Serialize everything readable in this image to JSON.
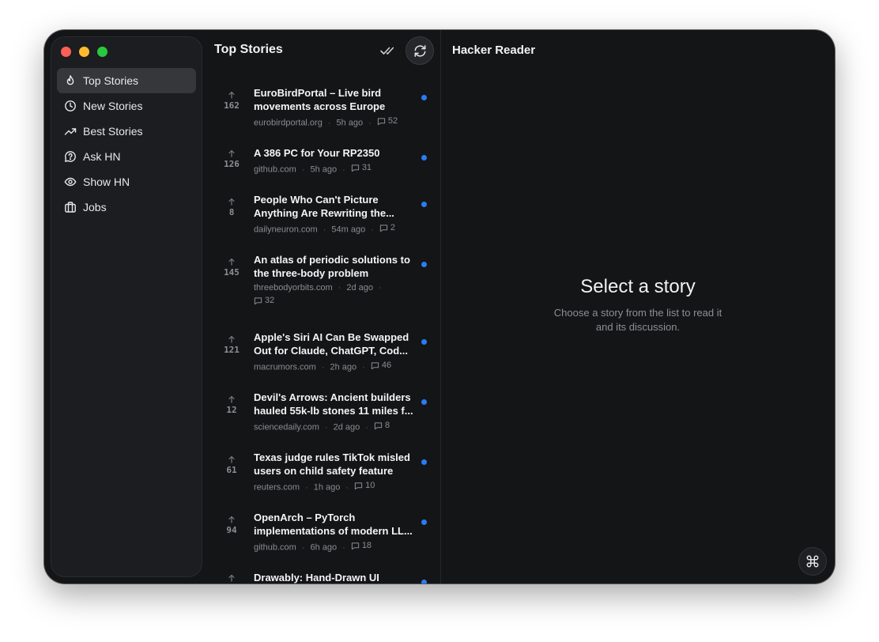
{
  "colors": {
    "accent": "#2a7cf6",
    "close": "#fe5f57",
    "minimize": "#febc2e",
    "zoom": "#28c840"
  },
  "sidebar": {
    "items": [
      {
        "label": "Top Stories",
        "icon": "flame-icon",
        "active": true
      },
      {
        "label": "New Stories",
        "icon": "clock-icon"
      },
      {
        "label": "Best Stories",
        "icon": "trending-up-icon"
      },
      {
        "label": "Ask HN",
        "icon": "help-circle-icon"
      },
      {
        "label": "Show HN",
        "icon": "eye-icon"
      },
      {
        "label": "Jobs",
        "icon": "briefcase-icon"
      }
    ]
  },
  "list": {
    "title": "Top Stories",
    "mark_read_icon": "check-check-icon",
    "refresh_icon": "refresh-icon",
    "stories": [
      {
        "points": "162",
        "title_lines": [
          "EuroBirdPortal – Live bird",
          "movements across Europe"
        ],
        "domain": "eurobirdportal.org",
        "age": "5h ago",
        "comments": "52",
        "unread": true
      },
      {
        "points": "126",
        "title_lines": [
          "A 386 PC for Your RP2350"
        ],
        "domain": "github.com",
        "age": "5h ago",
        "comments": "31",
        "unread": true
      },
      {
        "points": "8",
        "title_lines": [
          "People Who Can't Picture",
          "Anything Are Rewriting the..."
        ],
        "domain": "dailyneuron.com",
        "age": "54m ago",
        "comments": "2",
        "unread": true
      },
      {
        "points": "145",
        "title_lines": [
          "An atlas of periodic solutions to",
          "the three-body problem"
        ],
        "domain": "threebodyorbits.com",
        "age": "2d ago",
        "comments": "32",
        "unread": true
      },
      {
        "points": "121",
        "title_lines": [
          "Apple's Siri AI Can Be Swapped",
          "Out for Claude, ChatGPT, Cod..."
        ],
        "domain": "macrumors.com",
        "age": "2h ago",
        "comments": "46",
        "unread": true
      },
      {
        "points": "12",
        "title_lines": [
          "Devil's Arrows: Ancient builders",
          "hauled 55k-lb stones 11 miles f..."
        ],
        "domain": "sciencedaily.com",
        "age": "2d ago",
        "comments": "8",
        "unread": true
      },
      {
        "points": "61",
        "title_lines": [
          "Texas judge rules TikTok misled",
          "users on child safety feature"
        ],
        "domain": "reuters.com",
        "age": "1h ago",
        "comments": "10",
        "unread": true
      },
      {
        "points": "94",
        "title_lines": [
          "OpenArch – PyTorch",
          "implementations of modern LL..."
        ],
        "domain": "github.com",
        "age": "6h ago",
        "comments": "18",
        "unread": true
      },
      {
        "points": "",
        "title_lines": [
          "Drawably: Hand-Drawn UI"
        ],
        "domain": "",
        "age": "",
        "comments": "",
        "unread": true
      }
    ]
  },
  "detail": {
    "app_title": "Hacker Reader",
    "empty_title": "Select a story",
    "empty_subtitle_lines": [
      "Choose a story from the list to read it",
      "and its discussion."
    ],
    "command_icon": "command-icon"
  }
}
